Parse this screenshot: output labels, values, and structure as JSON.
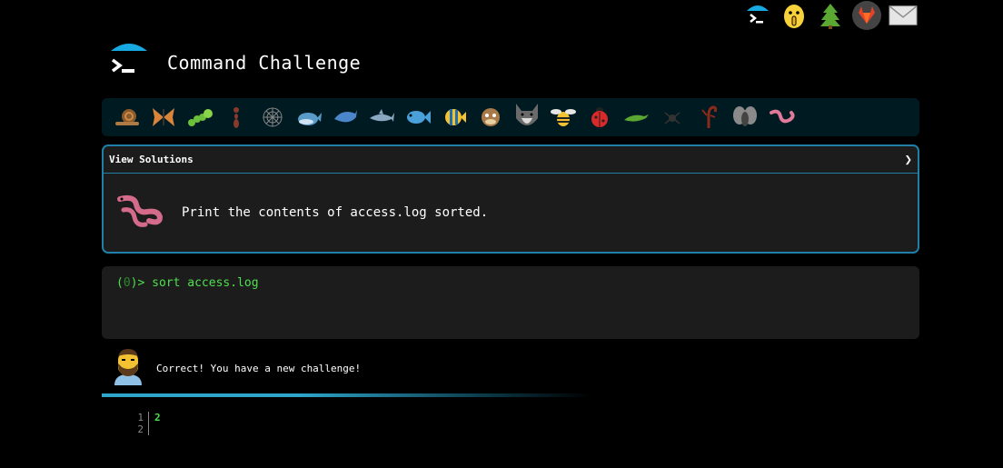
{
  "app": {
    "title": "Command Challenge"
  },
  "top_icons": [
    {
      "name": "terminal-logo-icon"
    },
    {
      "name": "shushing-face-icon"
    },
    {
      "name": "tree-icon"
    },
    {
      "name": "gitlab-icon"
    },
    {
      "name": "mail-icon"
    }
  ],
  "creatures": [
    "snail-icon",
    "butterfly-icon",
    "caterpillar-icon",
    "ant-icon",
    "spider-web-icon",
    "whale-icon",
    "dolphin-icon",
    "shark-icon",
    "fish-icon",
    "tropical-fish-icon",
    "pufferfish-icon",
    "wolf-icon",
    "bee-icon",
    "ladybug-icon",
    "lizard-icon",
    "spider-icon",
    "scorpion-icon",
    "fly-icon",
    "worm-icon"
  ],
  "challenge": {
    "view_solutions_label": "View Solutions",
    "chevron": "❯",
    "task": "Print the contents of access.log sorted.",
    "icon": "worm-icon"
  },
  "terminal": {
    "prompt_open": "(",
    "exit_code": "0",
    "prompt_close": ")> ",
    "command": "sort access.log"
  },
  "feedback": {
    "message": "Correct! You have a new challenge!",
    "avatar": "bearded-man-avatar"
  },
  "output": {
    "line_numbers": [
      "1",
      "2"
    ],
    "lines": [
      "2",
      ""
    ]
  },
  "colors": {
    "accent": "#1f7fa6",
    "terminal_text": "#4ee04e",
    "panel_bg": "#1c1c1c",
    "creature_bar_bg": "#001a22"
  }
}
